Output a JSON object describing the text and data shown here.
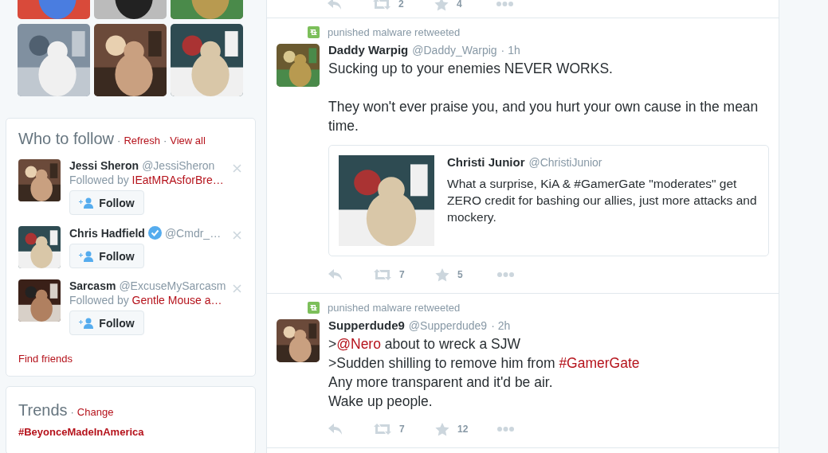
{
  "who_to_follow": {
    "title": "Who to follow",
    "actions": [
      {
        "separator": "·",
        "label": "Refresh"
      },
      {
        "separator": "·",
        "label": "View all"
      }
    ],
    "suggestions": [
      {
        "name": "Jessi Sheron",
        "handle": "@JessiSheron",
        "verified": false,
        "followed_by_prefix": "Followed by ",
        "followed_by": "IEatMRAsforBre…",
        "button": "Follow"
      },
      {
        "name": "Chris Hadfield",
        "handle": "@Cmdr_…",
        "verified": true,
        "button": "Follow"
      },
      {
        "name": "Sarcasm",
        "handle": "@ExcuseMySarcasm",
        "verified": false,
        "followed_by_prefix": "Followed by ",
        "followed_by": "Gentle Mouse a…",
        "button": "Follow"
      }
    ],
    "find_friends": "Find friends"
  },
  "trends": {
    "title": "Trends",
    "separator": "·",
    "action": "Change",
    "items": [
      "#BeyonceMadeInAmerica"
    ]
  },
  "timeline": {
    "previous_actions": {
      "retweets": "2",
      "favorites": "4"
    },
    "tweets": [
      {
        "retweeted_by": "punished malware retweeted",
        "name": "Daddy Warpig",
        "handle": "@Daddy_Warpig",
        "time": "· 1h",
        "paragraphs": [
          [
            [
              {
                "kind": "text",
                "text": "Sucking up to your enemies NEVER WORKS."
              }
            ]
          ],
          [
            [
              {
                "kind": "text",
                "text": "They won't ever praise you, and you hurt your own cause in the mean time."
              }
            ]
          ]
        ],
        "quote": {
          "name": "Christi Junior",
          "handle": "@ChristiJunior",
          "text": "What a surprise, KiA & #GamerGate \"moderates\" get ZERO credit for bashing our allies, just more attacks and mockery."
        },
        "retweets": "7",
        "favorites": "5"
      },
      {
        "retweeted_by": "punished malware retweeted",
        "name": "Supperdude9",
        "handle": "@Supperdude9",
        "time": "· 2h",
        "paragraphs": [
          [
            [
              {
                "kind": "text",
                "text": ">"
              },
              {
                "kind": "link",
                "text": "@Nero"
              },
              {
                "kind": "text",
                "text": " about to wreck a SJW"
              }
            ],
            [
              {
                "kind": "text",
                "text": ">Sudden shilling to remove him from "
              },
              {
                "kind": "link",
                "text": "#GamerGate"
              }
            ],
            [
              {
                "kind": "text",
                "text": "Any more transparent and it'd be air."
              }
            ],
            [
              {
                "kind": "text",
                "text": "Wake up people."
              }
            ]
          ]
        ],
        "retweets": "7",
        "favorites": "12"
      }
    ]
  }
}
